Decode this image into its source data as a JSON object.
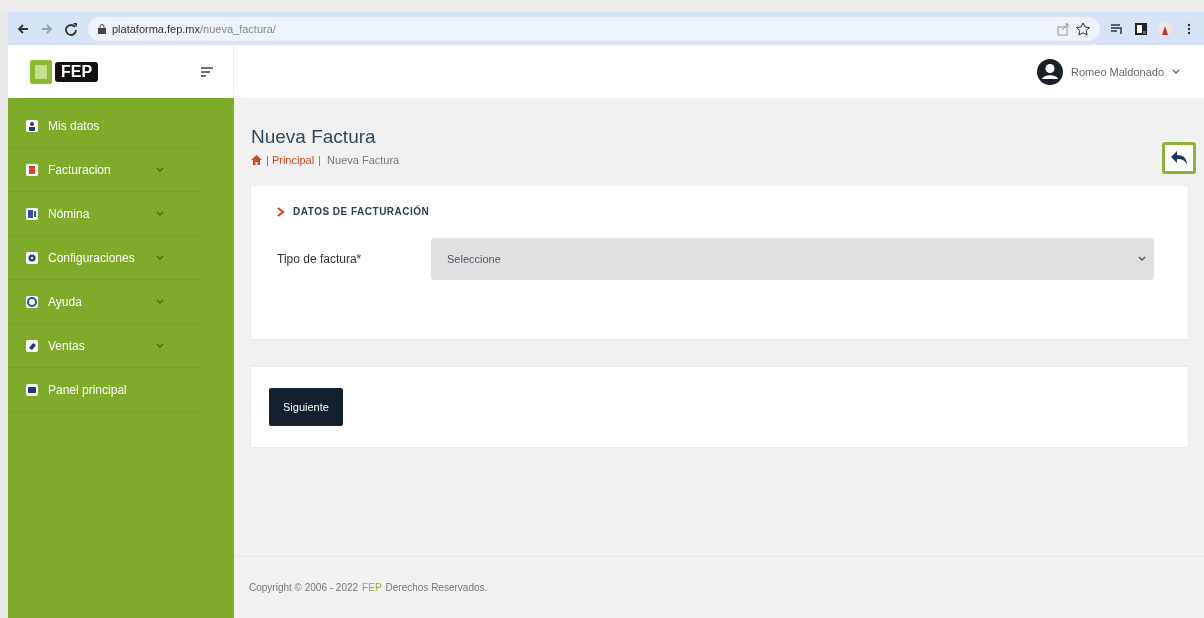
{
  "browser": {
    "url_host": "plataforma.fep.mx",
    "url_path": "/nueva_factura/"
  },
  "header": {
    "logo": "FEP",
    "user_name": "Romeo Maldonado"
  },
  "sidebar": {
    "items": [
      {
        "label": "Mis datos",
        "has_submenu": false
      },
      {
        "label": "Facturacion",
        "has_submenu": true
      },
      {
        "label": "Nómina",
        "has_submenu": true
      },
      {
        "label": "Configuraciones",
        "has_submenu": true
      },
      {
        "label": "Ayuda",
        "has_submenu": true
      },
      {
        "label": "Ventas",
        "has_submenu": true
      },
      {
        "label": "Panel principal",
        "has_submenu": false
      }
    ]
  },
  "page": {
    "title": "Nueva Factura",
    "breadcrumb": [
      {
        "label": "| Principal",
        "kind": "link"
      },
      {
        "label": "|  Nueva Factura",
        "kind": "current"
      }
    ]
  },
  "form": {
    "section_title": "DATOS DE FACTURACIÓN",
    "field_label": "Tipo de factura*",
    "select_value": "Seleccione"
  },
  "actions": {
    "next_button": "Siguiente"
  },
  "footer": {
    "prefix": "Copyright © 2006 - 2022",
    "brand": "FEP",
    "suffix": "Derechos Reservados."
  }
}
